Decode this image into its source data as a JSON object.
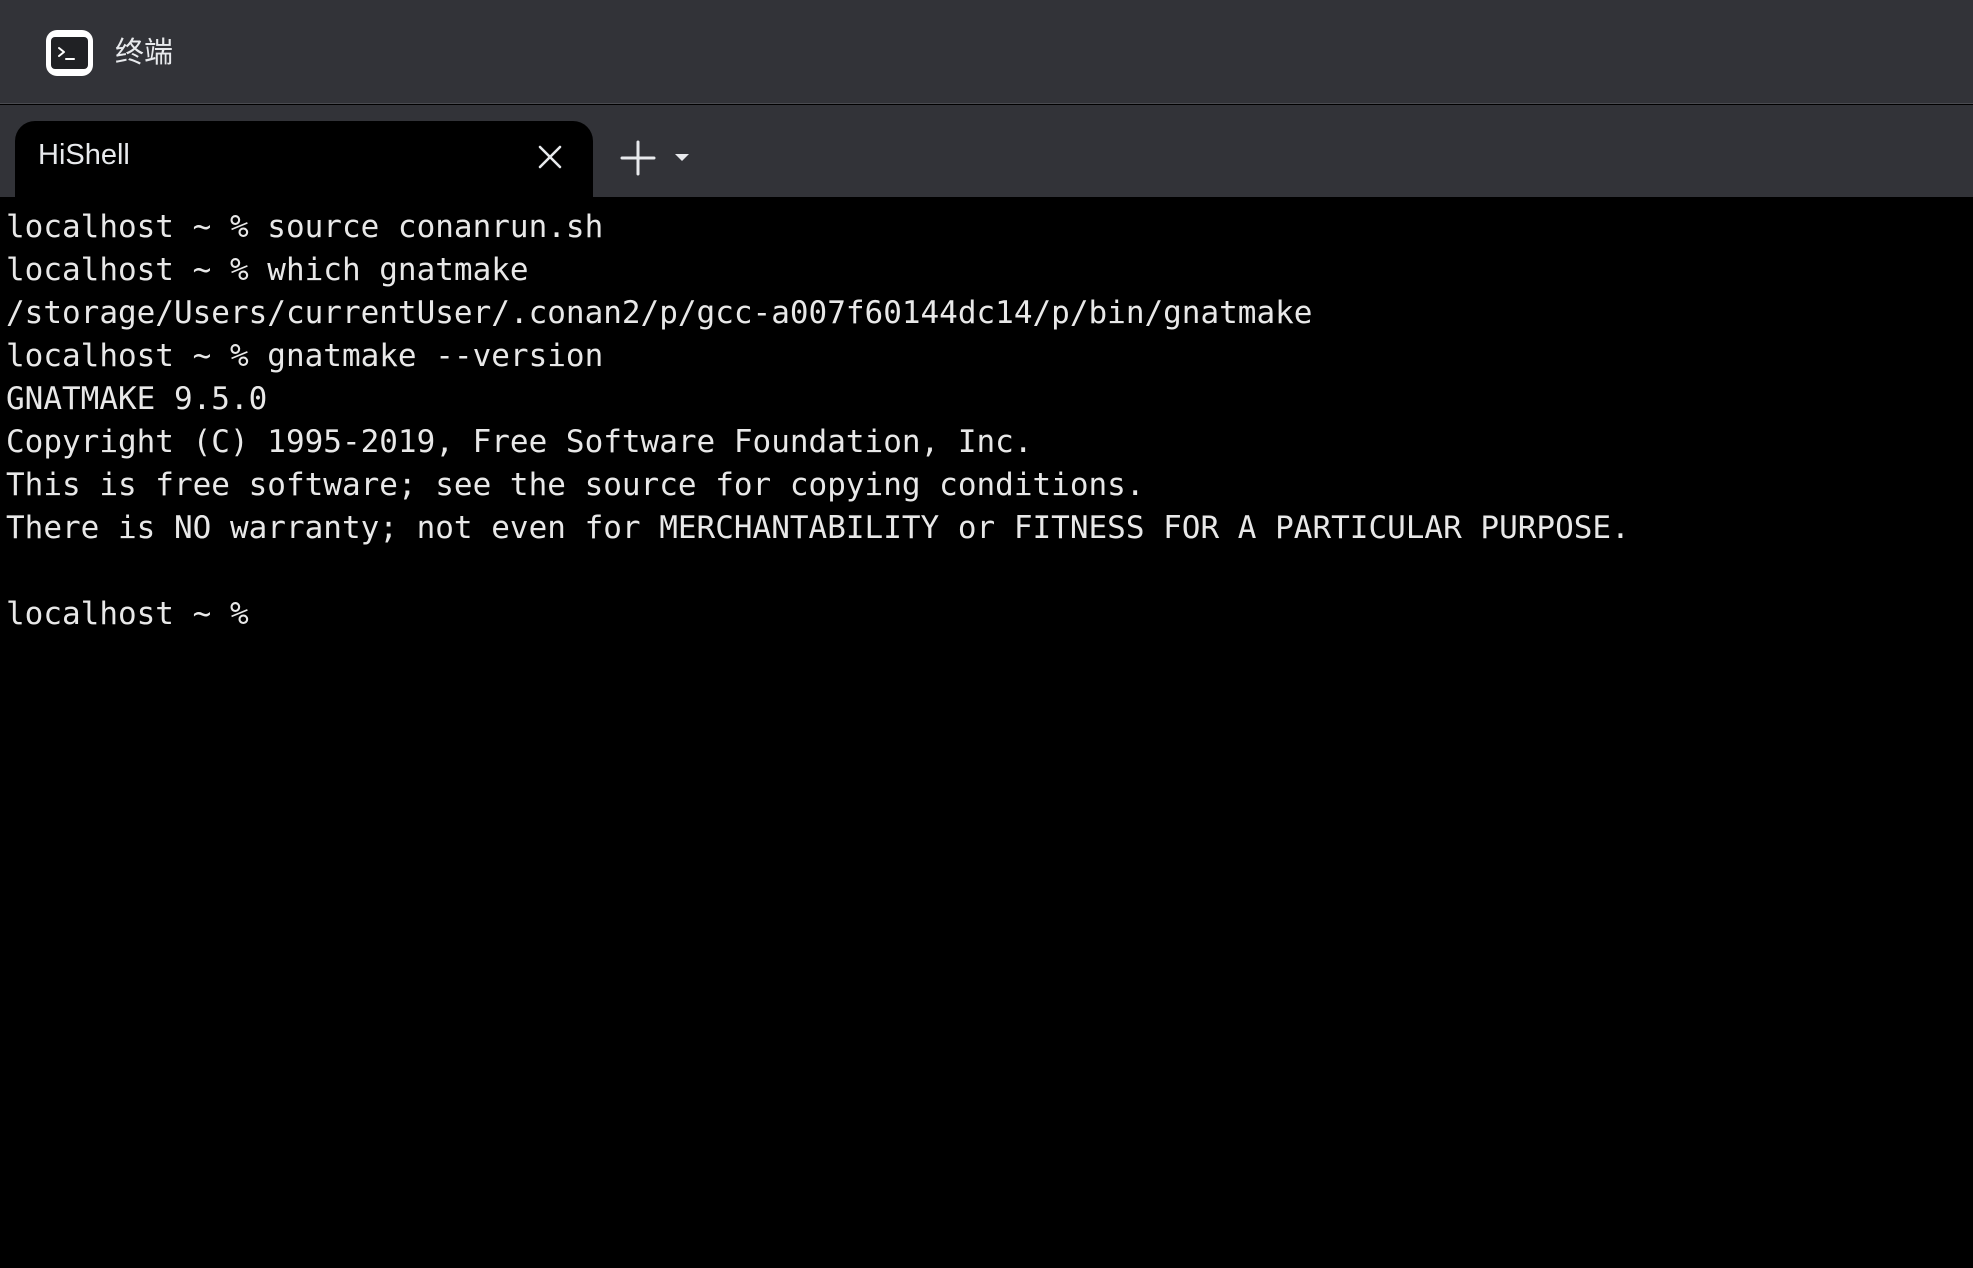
{
  "app": {
    "title": "终端",
    "icon": "terminal-app-icon"
  },
  "tabs": [
    {
      "label": "HiShell",
      "active": true,
      "close_icon": "close-icon"
    }
  ],
  "tabbar": {
    "new_tab_icon": "plus-icon",
    "new_tab_menu_icon": "caret-down-icon"
  },
  "terminal": {
    "lines": [
      "localhost ~ % source conanrun.sh",
      "localhost ~ % which gnatmake",
      "/storage/Users/currentUser/.conan2/p/gcc-a007f60144dc14/p/bin/gnatmake",
      "localhost ~ % gnatmake --version",
      "GNATMAKE 9.5.0",
      "Copyright (C) 1995-2019, Free Software Foundation, Inc.",
      "This is free software; see the source for copying conditions.",
      "There is NO warranty; not even for MERCHANTABILITY or FITNESS FOR A PARTICULAR PURPOSE.",
      "",
      "localhost ~ %"
    ]
  },
  "colors": {
    "chrome_background": "#323338",
    "terminal_background": "#000000",
    "terminal_text": "#e8e8e8",
    "chrome_text": "#e8eaed"
  }
}
